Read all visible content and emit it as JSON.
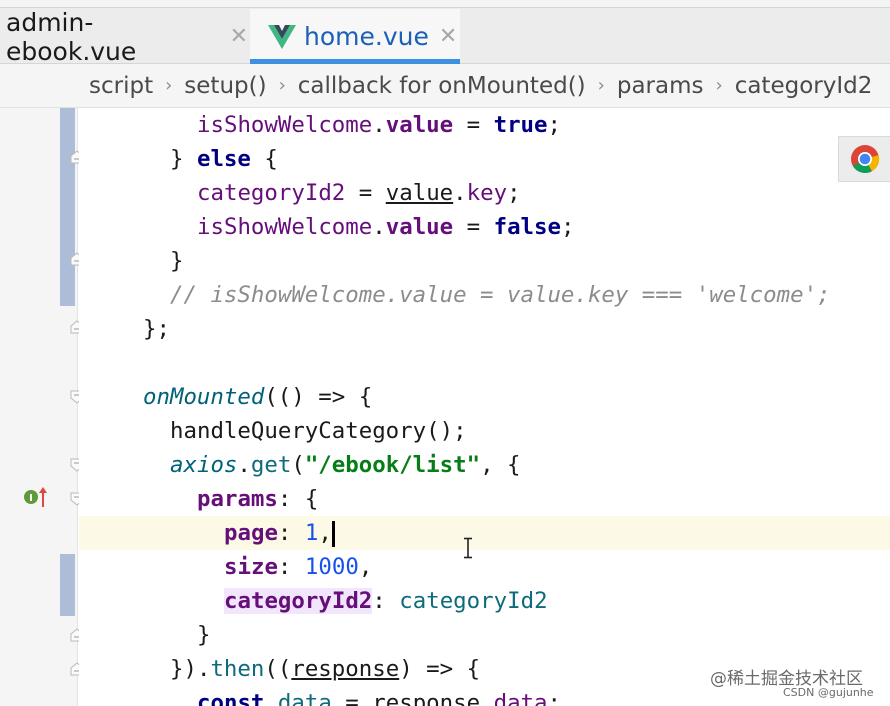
{
  "tabs": [
    {
      "label": "admin-ebook.vue",
      "active": false
    },
    {
      "label": "home.vue",
      "active": true
    }
  ],
  "breadcrumb": [
    "script",
    "setup()",
    "callback for onMounted()",
    "params",
    "categoryId2"
  ],
  "watermark": "@稀土掘金技术社区",
  "watermark_small": "CSDN @gujunhe",
  "colors": {
    "keyword": "#000080",
    "property": "#660e7a",
    "string": "#067d17",
    "number": "#1750eb",
    "comment": "#8c8c8c",
    "active_tab": "#3d8fe0"
  },
  "icons": [
    "vue-icon",
    "close-icon",
    "chrome-icon",
    "fold-icon",
    "implements-marker-icon",
    "text-cursor-icon"
  ],
  "code": {
    "l1": {
      "a": "isShowWelcome",
      "b": ".",
      "c": "value",
      "d": " = ",
      "e": "true",
      "f": ";"
    },
    "l2": {
      "a": "} ",
      "b": "else",
      "c": " {"
    },
    "l3": {
      "a": "categoryId2",
      "b": " = ",
      "c": "value",
      "d": ".",
      "e": "key",
      "f": ";"
    },
    "l4": {
      "a": "isShowWelcome",
      "b": ".",
      "c": "value",
      "d": " = ",
      "e": "false",
      "f": ";"
    },
    "l5": {
      "a": "}"
    },
    "l6": {
      "a": "// isShowWelcome.value = value.key === 'welcome';"
    },
    "l7": {
      "a": "};"
    },
    "l9": {
      "a": "onMounted",
      "b": "(() => {"
    },
    "l10": {
      "a": "handleQueryCategory();"
    },
    "l11": {
      "a": "axios",
      "b": ".",
      "c": "get",
      "d": "(",
      "e": "\"/ebook/list\"",
      "f": ", {"
    },
    "l12": {
      "a": "params",
      "b": ": {"
    },
    "l13": {
      "a": "page",
      "b": ": ",
      "c": "1",
      "d": ","
    },
    "l14": {
      "a": "size",
      "b": ": ",
      "c": "1000",
      "d": ","
    },
    "l15": {
      "a": "categoryId2",
      "b": ": ",
      "c": "categoryId2"
    },
    "l16": {
      "a": "}"
    },
    "l17": {
      "a": "}).",
      "b": "then",
      "c": "((",
      "d": "response",
      "e": ") => {"
    },
    "l18": {
      "a": "const",
      "b": " data",
      "c": " = ",
      "d": "response",
      "e": ".",
      "f": "data",
      "g": ";"
    }
  }
}
